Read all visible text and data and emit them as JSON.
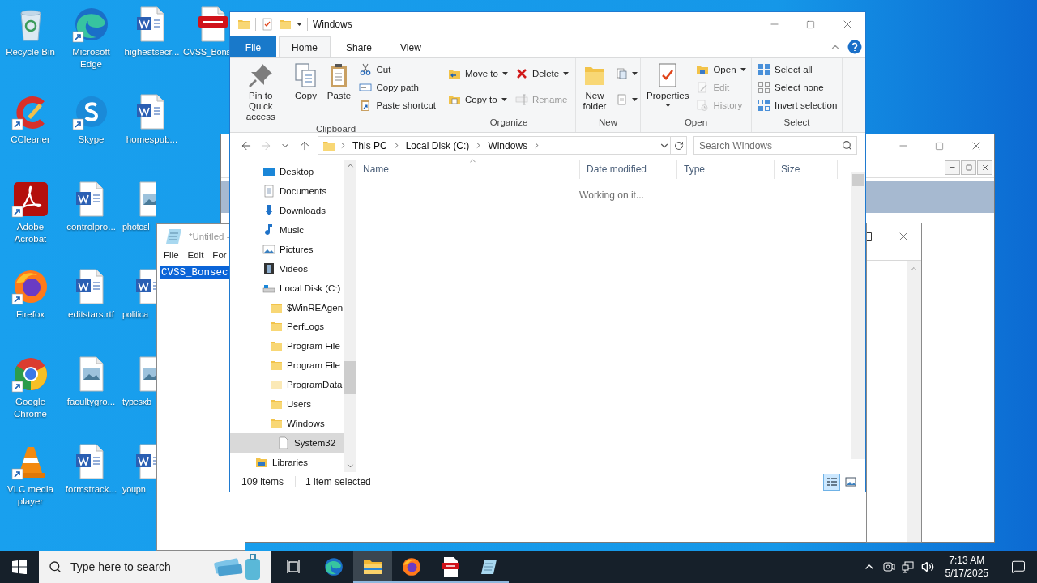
{
  "desktop": {
    "icons": [
      {
        "label": "Recycle Bin",
        "kind": "recycle",
        "shortcut": false
      },
      {
        "label": "CCleaner",
        "kind": "ccleaner",
        "shortcut": true
      },
      {
        "label": "Adobe Acrobat",
        "kind": "acrobat",
        "shortcut": true
      },
      {
        "label": "Firefox",
        "kind": "firefox",
        "shortcut": true
      },
      {
        "label": "Google Chrome",
        "kind": "chrome",
        "shortcut": true
      },
      {
        "label": "VLC media player",
        "kind": "vlc",
        "shortcut": true
      },
      {
        "label": "Microsoft Edge",
        "kind": "edge",
        "shortcut": true
      },
      {
        "label": "Skype",
        "kind": "skype",
        "shortcut": true
      },
      {
        "label": "controlpro...",
        "kind": "word",
        "shortcut": false
      },
      {
        "label": "editstars.rtf",
        "kind": "word",
        "shortcut": false
      },
      {
        "label": "facultygro...",
        "kind": "image",
        "shortcut": false
      },
      {
        "label": "formstrack...",
        "kind": "word",
        "shortcut": false
      },
      {
        "label": "highestsecr...",
        "kind": "word",
        "shortcut": false
      },
      {
        "label": "homespub...",
        "kind": "word",
        "shortcut": false
      },
      {
        "label": "photosl",
        "kind": "image",
        "shortcut": false
      },
      {
        "label": "politica",
        "kind": "word",
        "shortcut": false
      },
      {
        "label": "typesxb",
        "kind": "image",
        "shortcut": false
      },
      {
        "label": "youpn",
        "kind": "word",
        "shortcut": false
      },
      {
        "label": "CVSS_Bons",
        "kind": "pdf",
        "shortcut": false
      }
    ]
  },
  "notepad": {
    "title": "*Untitled -",
    "menu": [
      "File",
      "Edit",
      "For"
    ],
    "text": "CVSS_Bonsec",
    "text_selected": true
  },
  "explorer": {
    "title": "Windows",
    "tabs": [
      {
        "label": "File",
        "kind": "file",
        "selected": false
      },
      {
        "label": "Home",
        "kind": "tab",
        "selected": true
      },
      {
        "label": "Share",
        "kind": "tab",
        "selected": false
      },
      {
        "label": "View",
        "kind": "tab",
        "selected": false
      }
    ],
    "ribbon": [
      {
        "label": "Clipboard",
        "columns": [
          {
            "kind": "large",
            "items": [
              {
                "label": "Pin to Quick access",
                "kind": "pin",
                "menu": false,
                "disabled": false
              }
            ]
          },
          {
            "kind": "large",
            "items": [
              {
                "label": "Copy",
                "kind": "copy",
                "menu": false,
                "disabled": false
              }
            ]
          },
          {
            "kind": "large",
            "items": [
              {
                "label": "Paste",
                "kind": "paste",
                "menu": false,
                "disabled": false
              }
            ]
          },
          {
            "kind": "small",
            "items": [
              {
                "label": "Cut",
                "kind": "cut",
                "menu": false,
                "disabled": false
              },
              {
                "label": "Copy path",
                "kind": "copy_path",
                "menu": false,
                "disabled": false
              },
              {
                "label": "Paste shortcut",
                "kind": "paste_shortcut",
                "menu": false,
                "disabled": false
              }
            ]
          }
        ]
      },
      {
        "label": "Organize",
        "columns": [
          {
            "kind": "small",
            "items": [
              {
                "label": "Move to",
                "kind": "move_to",
                "menu": true,
                "disabled": false
              },
              {
                "label": "Copy to",
                "kind": "copy_to",
                "menu": true,
                "disabled": false
              }
            ]
          },
          {
            "kind": "small",
            "items": [
              {
                "label": "Delete",
                "kind": "delete",
                "menu": true,
                "disabled": false
              },
              {
                "label": "Rename",
                "kind": "rename",
                "menu": false,
                "disabled": true
              }
            ]
          }
        ]
      },
      {
        "label": "New",
        "columns": [
          {
            "kind": "large",
            "items": [
              {
                "label": "New folder",
                "kind": "new_folder",
                "menu": false,
                "disabled": false
              }
            ]
          },
          {
            "kind": "small",
            "items": [
              {
                "kind": "new_item",
                "menu": true,
                "disabled": false
              },
              {
                "kind": "easy_access",
                "menu": true,
                "disabled": false
              }
            ]
          }
        ]
      },
      {
        "label": "Open",
        "columns": [
          {
            "kind": "large",
            "items": [
              {
                "label": "Properties",
                "kind": "properties",
                "menu": true,
                "disabled": false
              }
            ]
          },
          {
            "kind": "small",
            "items": [
              {
                "label": "Open",
                "kind": "open",
                "menu": true,
                "disabled": false
              },
              {
                "label": "Edit",
                "kind": "edit",
                "menu": false,
                "disabled": true
              },
              {
                "label": "History",
                "kind": "history",
                "menu": false,
                "disabled": true
              }
            ]
          }
        ]
      },
      {
        "label": "Select",
        "columns": [
          {
            "kind": "small",
            "items": [
              {
                "label": "Select all",
                "kind": "select_all",
                "menu": false,
                "disabled": false
              },
              {
                "label": "Select none",
                "kind": "select_none",
                "menu": false,
                "disabled": false
              },
              {
                "label": "Invert selection",
                "kind": "invert",
                "menu": false,
                "disabled": false
              }
            ]
          }
        ]
      }
    ],
    "nav_buttons": [
      {
        "kind": "back",
        "disabled": false
      },
      {
        "kind": "forward",
        "disabled": true
      },
      {
        "kind": "recent",
        "disabled": false
      },
      {
        "kind": "up",
        "disabled": false
      }
    ],
    "breadcrumbs": [
      "This PC",
      "Local Disk (C:)",
      "Windows"
    ],
    "search": {
      "placeholder": "Search Windows"
    },
    "nav": {
      "items": [
        {
          "label": "Desktop",
          "kind": "desktop",
          "selected": false
        },
        {
          "label": "Documents",
          "kind": "documents",
          "selected": false
        },
        {
          "label": "Downloads",
          "kind": "downloads",
          "selected": false
        },
        {
          "label": "Music",
          "kind": "music",
          "selected": false
        },
        {
          "label": "Pictures",
          "kind": "pictures",
          "selected": false
        },
        {
          "label": "Videos",
          "kind": "videos",
          "selected": false
        },
        {
          "label": "Local Disk (C:)",
          "kind": "drive",
          "selected": false,
          "children": [
            {
              "label": "$WinREAgen",
              "kind": "folder",
              "selected": false
            },
            {
              "label": "PerfLogs",
              "kind": "folder",
              "selected": false
            },
            {
              "label": "Program File",
              "kind": "folder",
              "selected": false
            },
            {
              "label": "Program File",
              "kind": "folder",
              "selected": false
            },
            {
              "label": "ProgramData",
              "kind": "folder_faded",
              "selected": false
            },
            {
              "label": "Users",
              "kind": "folder",
              "selected": false
            },
            {
              "label": "Windows",
              "kind": "folder",
              "selected": false,
              "children": [
                {
                  "label": "System32",
                  "kind": "file",
                  "selected": true
                }
              ]
            }
          ]
        }
      ],
      "root_items": [
        {
          "label": "Libraries",
          "kind": "libraries",
          "selected": false
        }
      ]
    },
    "columns": [
      "Name",
      "Date modified",
      "Type",
      "Size"
    ],
    "message": "Working on it...",
    "status": {
      "count": "109 items",
      "selection": "1 item selected"
    },
    "views": [
      {
        "kind": "details",
        "selected": true
      },
      {
        "kind": "large_icons",
        "selected": false
      }
    ]
  },
  "taskbar": {
    "search_placeholder": "Type here to search",
    "apps": [
      {
        "kind": "taskview",
        "selected": false,
        "running": false
      },
      {
        "kind": "edge",
        "selected": false,
        "running": false
      },
      {
        "kind": "explorer",
        "selected": true,
        "running": true
      },
      {
        "kind": "firefox",
        "selected": false,
        "running": true
      },
      {
        "kind": "pdf",
        "selected": false,
        "running": true
      },
      {
        "kind": "notepad",
        "selected": false,
        "running": true
      }
    ],
    "time": "7:13 AM",
    "date": "5/17/2025"
  }
}
